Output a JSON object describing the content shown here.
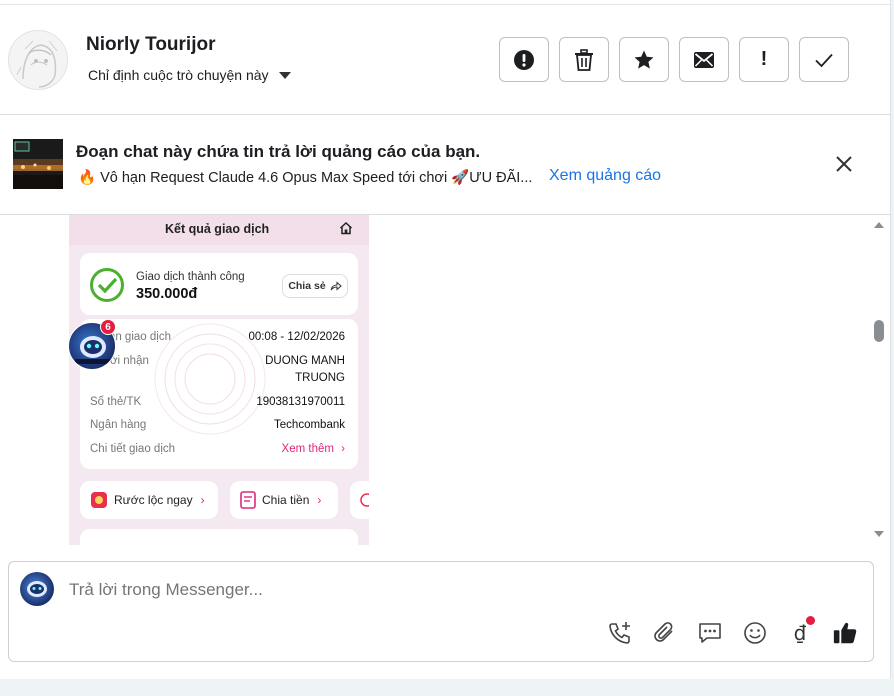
{
  "header": {
    "contact_name": "Niorly Tourijor",
    "assign_label": "Chỉ định cuộc trò chuyện này",
    "actions": [
      {
        "icon": "alert-circle-icon",
        "name": "mark-spam-button"
      },
      {
        "icon": "trash-icon",
        "name": "delete-button"
      },
      {
        "icon": "star-icon",
        "name": "star-button"
      },
      {
        "icon": "envelope-icon",
        "name": "mark-unread-button"
      },
      {
        "icon": "exclamation-icon",
        "name": "follow-up-button"
      },
      {
        "icon": "check-icon",
        "name": "mark-done-button"
      }
    ],
    "action_glyphs": {
      "exclamation": "!"
    }
  },
  "ad_banner": {
    "title": "Đoạn chat này chứa tin trả lời quảng cáo của bạn.",
    "description": "🔥 Vô hạn Request Claude 4.6 Opus Max Speed tới chơi 🚀ƯU ĐÃI...",
    "link": "Xem quảng cáo"
  },
  "receipt": {
    "title": "Kết quả giao dịch",
    "status": "Giao dịch thành công",
    "amount": "350.000đ",
    "share_label": "Chia sẻ",
    "rows": [
      {
        "label": "Thời gian giao dịch",
        "value": "00:08 - 12/02/2026"
      },
      {
        "label": "Người nhận",
        "value": "DUONG MANH TRUONG",
        "value_line1": "DUONG MANH",
        "value_line2": "TRUONG"
      },
      {
        "label": "Số thẻ/TK",
        "value": "19038131970011"
      },
      {
        "label": "Ngân hàng",
        "value": "Techcombank"
      },
      {
        "label": "Chi tiết giao dịch",
        "value": "Xem thêm"
      }
    ],
    "row_label_visible": {
      "time": "gian giao dịch",
      "recipient": "ời nhận"
    },
    "buttons": [
      {
        "label": "Rước lộc ngay"
      },
      {
        "label": "Chia tiền"
      }
    ],
    "avatar_badge": "6"
  },
  "composer": {
    "placeholder": "Trả lời trong Messenger...",
    "tools": [
      "call-add-icon",
      "paperclip-icon",
      "saved-reply-icon",
      "emoji-icon",
      "dong-currency-icon",
      "thumbs-up-icon"
    ],
    "currency_glyph": "₫"
  },
  "colors": {
    "link": "#1a73e8",
    "accent_pink": "#e0287a",
    "success_green": "#4caf2f",
    "badge_red": "#e41e3f"
  }
}
